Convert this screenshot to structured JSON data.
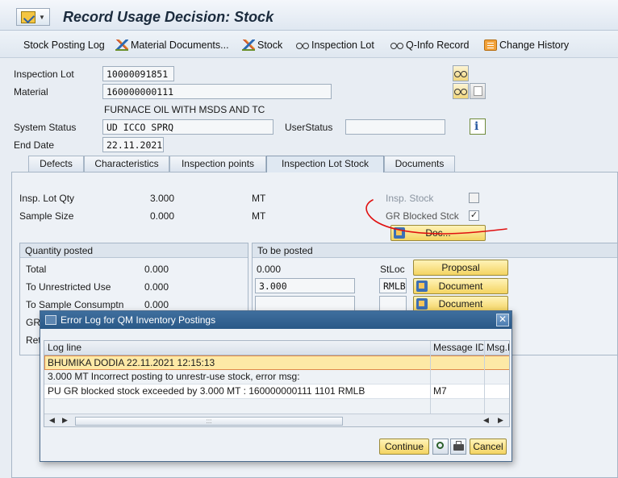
{
  "title": "Record Usage Decision: Stock",
  "toolbar": {
    "stock_posting_log": "Stock Posting Log",
    "material_documents": "Material Documents...",
    "stock": "Stock",
    "inspection_lot": "Inspection Lot",
    "q_info_record": "Q-Info Record",
    "change_history": "Change History"
  },
  "header": {
    "inspection_lot_label": "Inspection Lot",
    "inspection_lot_value": "10000091851",
    "material_label": "Material",
    "material_value": "160000000111",
    "material_description": "FURNACE OIL WITH MSDS AND TC",
    "system_status_label": "System Status",
    "system_status_value": "UD   ICCO SPRQ",
    "user_status_label": "UserStatus",
    "user_status_value": "",
    "end_date_label": "End Date",
    "end_date_value": "22.11.2021"
  },
  "tabs": [
    {
      "label": "Defects"
    },
    {
      "label": "Characteristics"
    },
    {
      "label": "Inspection points"
    },
    {
      "label": "Inspection Lot Stock",
      "active": true
    },
    {
      "label": "Documents"
    }
  ],
  "lot_stock": {
    "insp_lot_qty_label": "Insp. Lot Qty",
    "insp_lot_qty_value": "3.000",
    "insp_lot_qty_unit": "MT",
    "sample_size_label": "Sample Size",
    "sample_size_value": "0.000",
    "sample_size_unit": "MT",
    "insp_stock_label": "Insp. Stock",
    "insp_stock_checked": false,
    "gr_blocked_label": "GR Blocked Stck",
    "gr_blocked_checked": true,
    "gr_blocked_check_glyph": "✓",
    "doc_button": "Doc..."
  },
  "quantity_posted": {
    "title": "Quantity posted",
    "total_label": "Total",
    "total_value": "0.000",
    "unrestricted_label": "To Unrestricted Use",
    "unrestricted_value": "0.000",
    "sample_label": "To Sample Consumptn",
    "sample_value": "0.000",
    "row4_label": "GR",
    "row5_label": "Ret"
  },
  "to_be_posted": {
    "title": "To be posted",
    "total_value": "0.000",
    "unrestricted_value": "3.000",
    "sample_value": "",
    "stloc_label": "StLoc",
    "stloc_unrestricted": "RMLB",
    "stloc_sample": "",
    "proposal_button": "Proposal",
    "document_button_1": "Document",
    "document_button_2": "Document"
  },
  "dialog": {
    "title": "Error Log for QM Inventory Postings",
    "close_glyph": "✕",
    "columns": [
      "Log line",
      "Message ID",
      "Msg.N"
    ],
    "rows": [
      {
        "log": "BHUMIKA DODIA 22.11.2021 12:15:13",
        "msgid": "",
        "msgno": ""
      },
      {
        "log": "3.000 MT Incorrect posting to unrestr-use stock, error msg:",
        "msgid": "",
        "msgno": ""
      },
      {
        "log": "PU GR blocked stock exceeded by 3.000 MT : 160000000111 1101 RMLB",
        "msgid": "M7",
        "msgno": ""
      }
    ],
    "scroll_left": "◀",
    "scroll_right": "▶",
    "scroll_grip": ":::",
    "continue_button": "Continue",
    "cancel_button": "Cancel"
  },
  "colors": {
    "annotation_red": "#e01010",
    "dialog_title_bg": "#2a5987",
    "button_yellow": "#f4d462"
  }
}
